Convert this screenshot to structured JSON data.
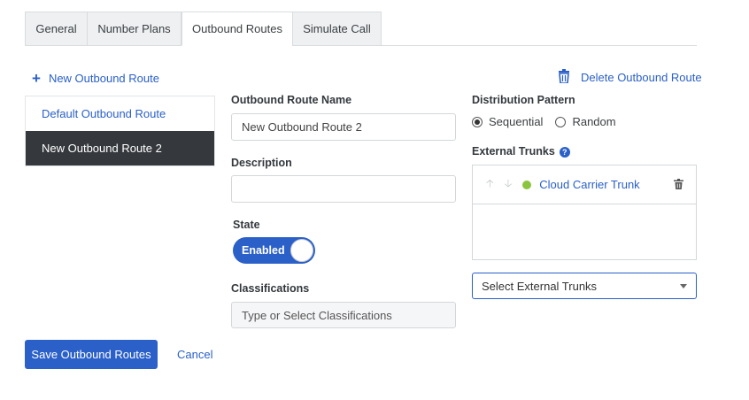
{
  "tabs": [
    {
      "label": "General"
    },
    {
      "label": "Number Plans"
    },
    {
      "label": "Outbound Routes"
    },
    {
      "label": "Simulate Call"
    }
  ],
  "actions": {
    "new_route": "New Outbound Route",
    "delete_route": "Delete Outbound Route",
    "save": "Save Outbound Routes",
    "cancel": "Cancel"
  },
  "routes": [
    {
      "name": "Default Outbound Route",
      "selected": false
    },
    {
      "name": "New Outbound Route 2",
      "selected": true
    }
  ],
  "form": {
    "name_label": "Outbound Route Name",
    "name_value": "New Outbound Route 2",
    "description_label": "Description",
    "description_value": "",
    "state_label": "State",
    "state_value": "Enabled",
    "classifications_label": "Classifications",
    "classifications_placeholder": "Type or Select Classifications"
  },
  "distribution": {
    "label": "Distribution Pattern",
    "options": [
      "Sequential",
      "Random"
    ],
    "selected": "Sequential"
  },
  "trunks": {
    "label": "External Trunks",
    "items": [
      {
        "name": "Cloud Carrier Trunk",
        "status": "active"
      }
    ],
    "select_placeholder": "Select External Trunks"
  },
  "colors": {
    "accent": "#2a60c8",
    "selected_row": "#35393d",
    "status_active": "#8bc53f"
  },
  "icons": {
    "add": "plus-icon",
    "delete": "trash-icon",
    "help": "question-circle-icon",
    "move_up": "arrow-up-icon",
    "move_down": "arrow-down-icon",
    "dropdown": "caret-down-icon"
  }
}
